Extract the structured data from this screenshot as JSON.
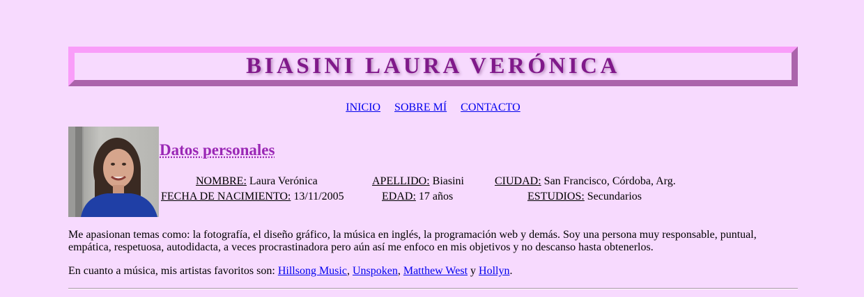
{
  "header": {
    "title": "BIASINI LAURA VERÓNICA"
  },
  "nav": {
    "items": [
      {
        "label": "INICIO"
      },
      {
        "label": "SOBRE MÍ"
      },
      {
        "label": "CONTACTO"
      }
    ]
  },
  "profile": {
    "section_title": "Datos personales",
    "fields": [
      {
        "label": "NOMBRE:",
        "value": "Laura Verónica"
      },
      {
        "label": "APELLIDO:",
        "value": "Biasini"
      },
      {
        "label": "CIUDAD:",
        "value": "San Francisco, Córdoba, Arg."
      },
      {
        "label": "FECHA DE NACIMIENTO:",
        "value": "13/11/2005"
      },
      {
        "label": "EDAD:",
        "value": "17 años"
      },
      {
        "label": "ESTUDIOS:",
        "value": "Secundarios"
      }
    ]
  },
  "about": {
    "paragraph": "Me apasionan temas como: la fotografía, el diseño gráfico, la música en inglés, la programación web y demás. Soy una persona muy responsable, puntual, empática, respetuosa, autodidacta, a veces procrastinadora pero aún así me enfoco en mis objetivos y no descanso hasta obtenerlos.",
    "music_intro": "En cuanto a música, mis artistas favoritos son: ",
    "artists": [
      "Hillsong Music",
      "Unspoken",
      "Matthew West",
      "Hollyn"
    ],
    "sep_comma": ", ",
    "sep_and": " y ",
    "end": "."
  },
  "colors": {
    "background": "#f7dafe",
    "banner_light": "#f99df9",
    "banner_dark": "#ab64ab",
    "title": "#80198a",
    "section_title": "#9a27b5",
    "link": "#0000ee"
  }
}
